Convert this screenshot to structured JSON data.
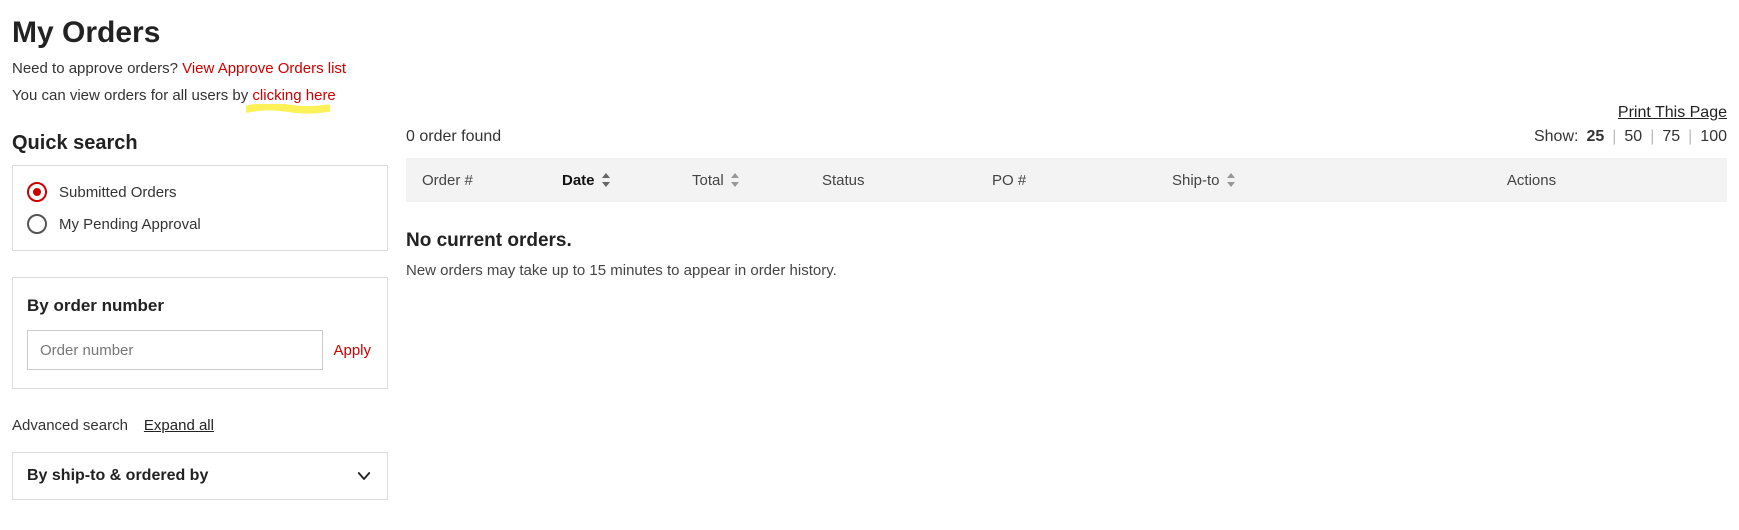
{
  "header": {
    "title": "My Orders",
    "approve_prefix": "Need to approve orders? ",
    "approve_link": "View Approve Orders list",
    "allusers_prefix": "You can view orders for all users by ",
    "allusers_link": "clicking here",
    "print_link": "Print This Page"
  },
  "sidebar": {
    "quick_search_heading": "Quick search",
    "filters": {
      "submitted_label": "Submitted Orders",
      "pending_label": "My Pending Approval",
      "selected": "submitted"
    },
    "by_order": {
      "heading": "By order number",
      "placeholder": "Order number",
      "apply_label": "Apply"
    },
    "advanced": {
      "label": "Advanced search",
      "expand_label": "Expand all",
      "accordion1": "By ship-to & ordered by"
    }
  },
  "results": {
    "count_text": "0 order found",
    "show_label": "Show:",
    "page_sizes": [
      "25",
      "50",
      "75",
      "100"
    ],
    "active_size": "25",
    "columns": {
      "order": "Order #",
      "date": "Date",
      "total": "Total",
      "status": "Status",
      "po": "PO #",
      "shipto": "Ship-to",
      "actions": "Actions"
    },
    "empty_title": "No current orders.",
    "empty_text": "New orders may take up to 15 minutes to appear in order history."
  }
}
